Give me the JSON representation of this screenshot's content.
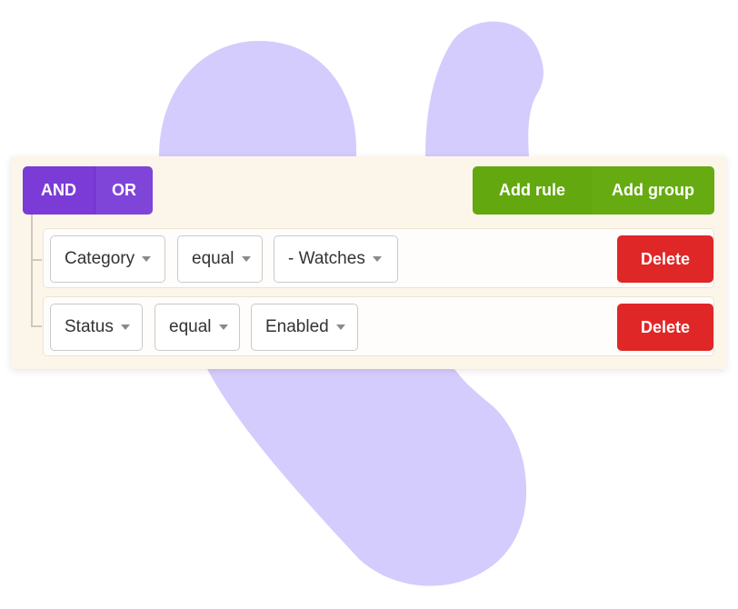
{
  "conjunction": {
    "and_label": "AND",
    "or_label": "OR",
    "selected": "AND"
  },
  "actions": {
    "add_rule_label": "Add rule",
    "add_group_label": "Add group"
  },
  "rules": [
    {
      "field": "Category",
      "operator": "equal",
      "value": "- Watches",
      "delete_label": "Delete"
    },
    {
      "field": "Status",
      "operator": "equal",
      "value": "Enabled",
      "delete_label": "Delete"
    }
  ],
  "colors": {
    "conjunction_accent": "#7b3bd6",
    "add_accent": "#63a80f",
    "delete_accent": "#e02727",
    "panel_background": "#fcf6ea",
    "decorative_blob": "#d4ccfd"
  },
  "icons": {
    "dropdown": "caret-down-icon"
  }
}
